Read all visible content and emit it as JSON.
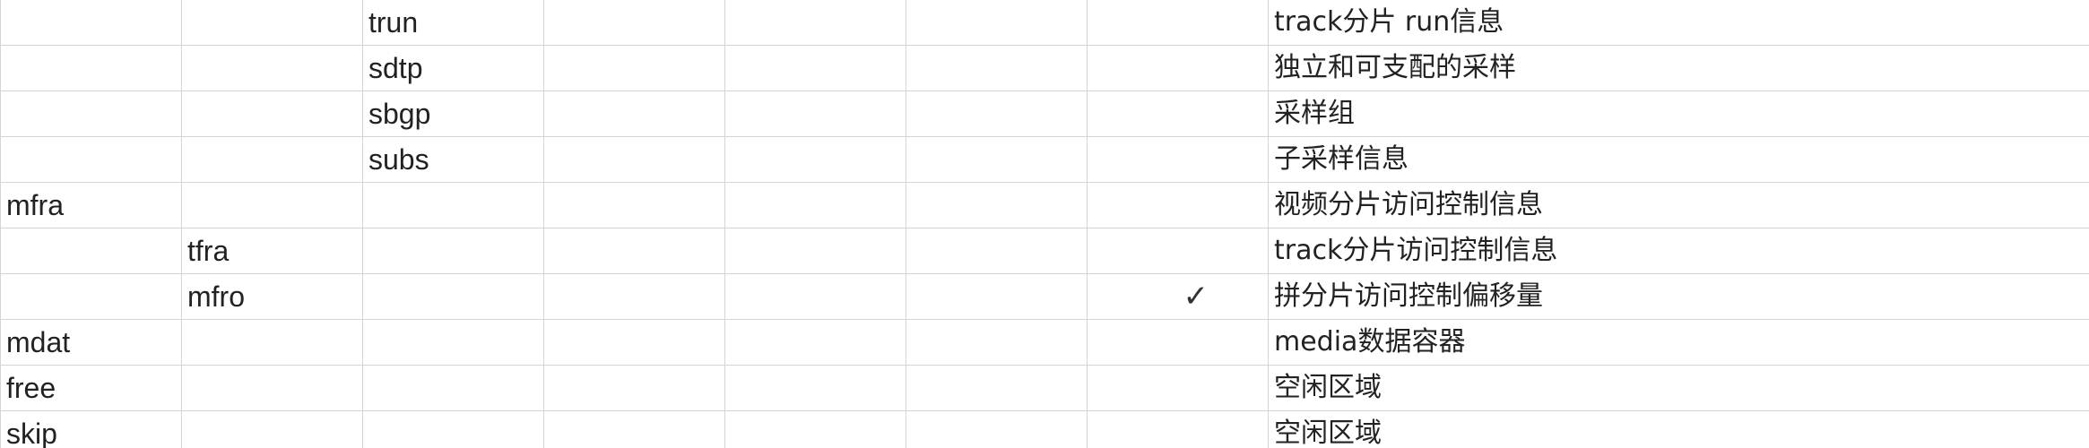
{
  "rows": [
    {
      "level1": "",
      "level2": "",
      "level3": "trun",
      "required": "",
      "description": "track分片 run信息"
    },
    {
      "level1": "",
      "level2": "",
      "level3": "sdtp",
      "required": "",
      "description": "独立和可支配的采样"
    },
    {
      "level1": "",
      "level2": "",
      "level3": "sbgp",
      "required": "",
      "description": "采样组"
    },
    {
      "level1": "",
      "level2": "",
      "level3": "subs",
      "required": "",
      "description": "子采样信息"
    },
    {
      "level1": "mfra",
      "level2": "",
      "level3": "",
      "required": "",
      "description": "视频分片访问控制信息"
    },
    {
      "level1": "",
      "level2": "tfra",
      "level3": "",
      "required": "",
      "description": "track分片访问控制信息"
    },
    {
      "level1": "",
      "level2": "mfro",
      "level3": "",
      "required": "✓",
      "description": "拼分片访问控制偏移量"
    },
    {
      "level1": "mdat",
      "level2": "",
      "level3": "",
      "required": "",
      "description": "media数据容器"
    },
    {
      "level1": "free",
      "level2": "",
      "level3": "",
      "required": "",
      "description": "空闲区域"
    },
    {
      "level1": "skip",
      "level2": "",
      "level3": "",
      "required": "",
      "description": "空闲区域"
    }
  ]
}
